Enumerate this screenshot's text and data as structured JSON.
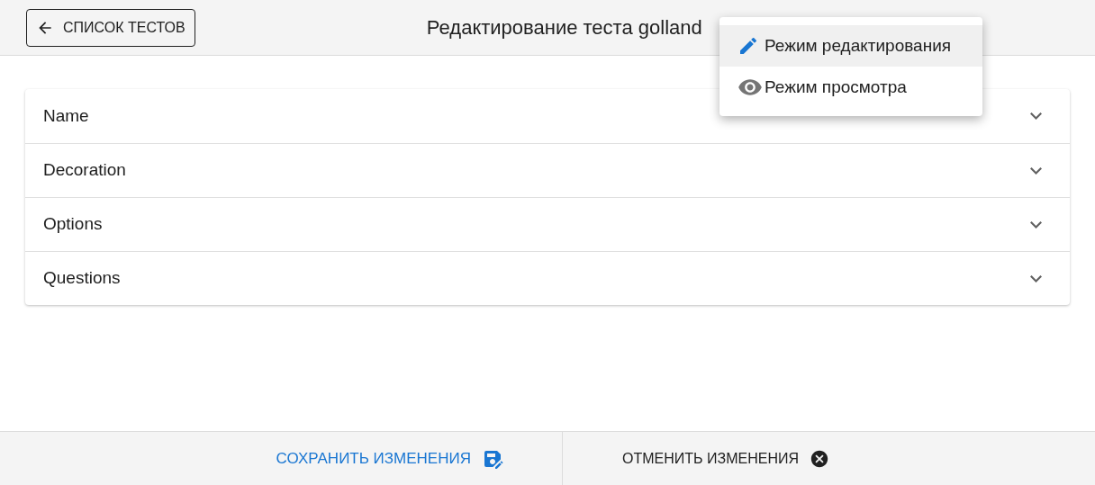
{
  "header": {
    "back_button": "СПИСОК ТЕСТОВ",
    "title": "Редактирование теста golland"
  },
  "mode_menu": [
    {
      "label": "Режим редактирования",
      "kind": "edit",
      "selected": true
    },
    {
      "label": "Режим просмотра",
      "kind": "view",
      "selected": false
    }
  ],
  "sections": [
    {
      "label": "Name",
      "expanded": false
    },
    {
      "label": "Decoration",
      "expanded": false
    },
    {
      "label": "Options",
      "expanded": false
    },
    {
      "label": "Questions",
      "expanded": false
    }
  ],
  "footer": {
    "save_button": "СОХРАНИТЬ ИЗМЕНЕНИЯ",
    "cancel_button": "ОТМЕНИТЬ ИЗМЕНЕНИЯ"
  }
}
